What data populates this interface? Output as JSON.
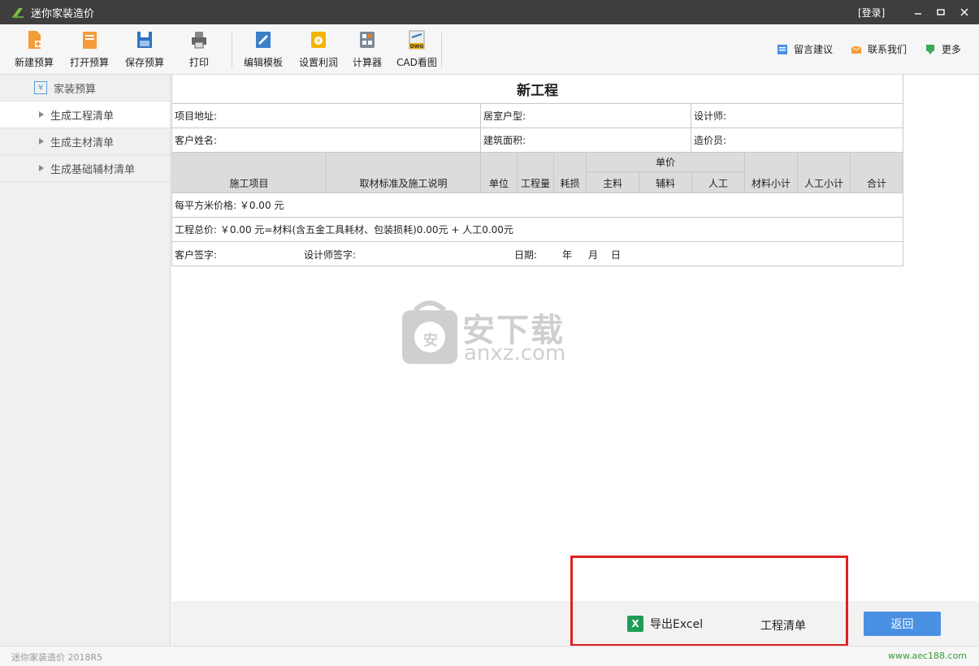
{
  "window": {
    "title": "迷你家装造价",
    "login": "[登录]"
  },
  "toolbar": {
    "buttons": [
      {
        "label": "新建预算",
        "icon": "new-file-icon"
      },
      {
        "label": "打开预算",
        "icon": "open-file-icon"
      },
      {
        "label": "保存预算",
        "icon": "save-icon"
      },
      {
        "label": "打印",
        "icon": "print-icon"
      },
      {
        "label": "编辑模板",
        "icon": "edit-template-icon"
      },
      {
        "label": "设置利润",
        "icon": "profit-icon"
      },
      {
        "label": "计算器",
        "icon": "calculator-icon"
      },
      {
        "label": "CAD看图",
        "icon": "dwg-icon"
      }
    ],
    "right_links": [
      {
        "label": "留言建议",
        "icon": "message-icon"
      },
      {
        "label": "联系我们",
        "icon": "mail-icon"
      },
      {
        "label": "更多",
        "icon": "more-icon"
      }
    ]
  },
  "sidebar": {
    "header": "家装预算",
    "items": [
      {
        "label": "生成工程清单",
        "active": true
      },
      {
        "label": "生成主材清单",
        "active": false
      },
      {
        "label": "生成基础辅材清单",
        "active": false
      }
    ]
  },
  "sheet": {
    "title": "新工程",
    "info": {
      "address": "项目地址:",
      "room_type": "居室户型:",
      "designer": "设计师:",
      "customer": "客户姓名:",
      "area": "建筑面积:",
      "estimator": "造价员:"
    },
    "unit_price_group": "单价",
    "columns": [
      "施工项目",
      "取材标准及施工说明",
      "单位",
      "工程量",
      "耗损",
      "主料",
      "辅料",
      "人工",
      "材料小计",
      "人工小计",
      "合计"
    ],
    "price_per_sqm": "每平方米价格: ￥0.00 元",
    "total": "工程总价: ￥0.00 元=材料(含五金工具耗材、包装损耗)0.00元 + 人工0.00元",
    "signature": {
      "customer": "客户签字:",
      "designer": "设计师签字:",
      "date": "日期:",
      "year": "年",
      "month": "月",
      "day": "日"
    }
  },
  "watermark": {
    "badge": "安",
    "text_cn": "安下载",
    "text_en": "anxz.com"
  },
  "actions": {
    "export": "导出Excel",
    "list": "工程清单",
    "back": "返回"
  },
  "status": {
    "version": "迷你家装造价 2018R5",
    "url": "www.aec188.com"
  }
}
